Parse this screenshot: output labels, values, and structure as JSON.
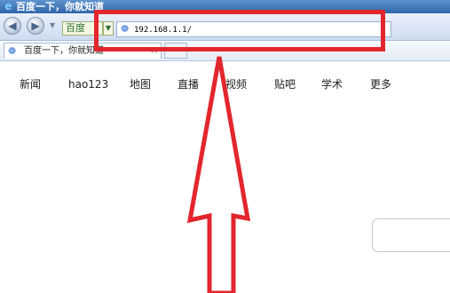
{
  "window": {
    "title": "百度一下，你就知道"
  },
  "navbar": {
    "back_icon": "back-arrow-icon",
    "forward_icon": "forward-arrow-icon",
    "search_engine_label": "百度",
    "address_icon": "baidu-paw-icon",
    "address_value": "192.168.1.1/"
  },
  "tabs": [
    {
      "label": "百度一下，你就知道",
      "icon": "baidu-paw-icon"
    }
  ],
  "page_nav": [
    {
      "label": "新闻"
    },
    {
      "label": "hao123"
    },
    {
      "label": "地图"
    },
    {
      "label": "直播"
    },
    {
      "label": "视频"
    },
    {
      "label": "贴吧"
    },
    {
      "label": "学术"
    },
    {
      "label": "更多"
    }
  ],
  "annotation": {
    "color": "#e3262d"
  }
}
